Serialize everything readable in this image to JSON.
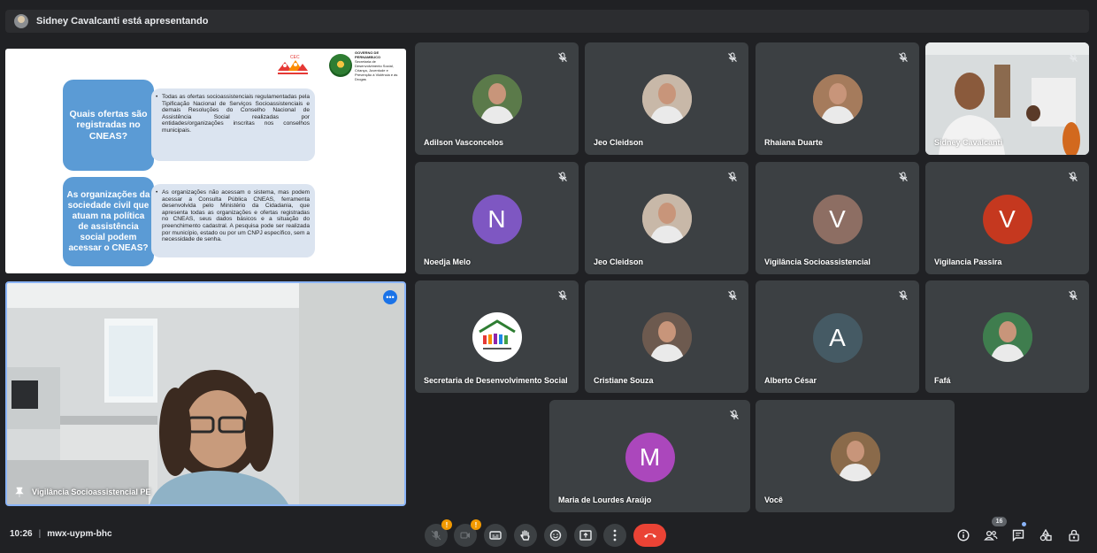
{
  "banner": {
    "text": "Sidney Cavalcanti está apresentando"
  },
  "slide": {
    "cec_label": "CEC",
    "gov_title": "GOVERNO DE PERNAMBUCO",
    "gov_sub": "Secretaria de Desenvolvimento Social, Criança, Juventude e Prevenção à Violência e às Drogas",
    "q1": "Quais ofertas são registradas no CNEAS?",
    "a1": "Todas as ofertas socioassistenciais regulamentadas pela Tipificação Nacional de Serviços Socioassistenciais e demais Resoluções do Conselho Nacional de Assistência Social realizadas por entidades/organizações inscritas nos conselhos municipais.",
    "q2": "As organizações da sociedade civil que atuam na política de assistência social podem acessar o CNEAS?",
    "a2": "As organizações não acessam o sistema, mas podem acessar a Consulta Pública CNEAS, ferramenta desenvolvida pelo Ministério da Cidadania, que apresenta todas as organizações e ofertas registradas no CNEAS, seus dados básicos e a situação do preenchimento cadastral. A pesquisa pode ser realizada por município, estado ou por um CNPJ específico, sem a necessidade de senha."
  },
  "pinned": {
    "name": "Vigilância Socioassistencial PE",
    "more": "•••"
  },
  "participants": [
    {
      "name": "Adilson Vasconcelos",
      "kind": "photo",
      "color": "#5b7a4a"
    },
    {
      "name": "Jeo Cleidson",
      "kind": "photo",
      "color": "#c8b8a8"
    },
    {
      "name": "Rhaiana Duarte",
      "kind": "photo",
      "color": "#a57b5c"
    },
    {
      "name": "Sidney Cavalcanti",
      "kind": "video",
      "color": "#cfd5d8"
    },
    {
      "name": "Noedja Melo",
      "kind": "letter",
      "letter": "N",
      "color": "#7e57c2"
    },
    {
      "name": "Jeo Cleidson",
      "kind": "photo",
      "color": "#c8b8a8"
    },
    {
      "name": "Vigilância Socioassistencial",
      "kind": "letter",
      "letter": "V",
      "color": "#8d6e63"
    },
    {
      "name": "Vigilancia Passira",
      "kind": "letter",
      "letter": "V",
      "color": "#c5381f"
    },
    {
      "name": "Secretaria de Desenvolvimento Social",
      "kind": "logo",
      "color": "#ffffff"
    },
    {
      "name": "Cristiane Souza",
      "kind": "photo",
      "color": "#6d5a4f"
    },
    {
      "name": "Alberto César",
      "kind": "letter",
      "letter": "A",
      "color": "#455a64"
    },
    {
      "name": "Fafá",
      "kind": "photo",
      "color": "#3f7d4e"
    },
    {
      "name": "Maria de Lourdes Araújo",
      "kind": "letter",
      "letter": "M",
      "color": "#ab47bc"
    },
    {
      "name": "Você",
      "kind": "photo",
      "color": "#8a6a4a"
    }
  ],
  "bottom": {
    "time": "10:26",
    "separator": "|",
    "meeting_code": "mwx-uypm-bhc",
    "mic_badge": "!",
    "cam_badge": "!",
    "people_count": "16"
  },
  "icons": {
    "mic": "mic-off-icon",
    "cam": "camera-off-icon",
    "captions": "captions-icon",
    "hand": "raise-hand-icon",
    "emoji": "emoji-icon",
    "present": "present-icon",
    "more": "more-options-icon",
    "end": "end-call-icon",
    "info": "info-icon",
    "people": "people-icon",
    "chat": "chat-icon",
    "activities": "activities-icon",
    "host": "host-controls-icon"
  },
  "colors": {
    "background": "#202124",
    "tile": "#3c4043",
    "accent_blue": "#8ab4f8",
    "end_call": "#ea4335",
    "warning": "#f29900"
  }
}
